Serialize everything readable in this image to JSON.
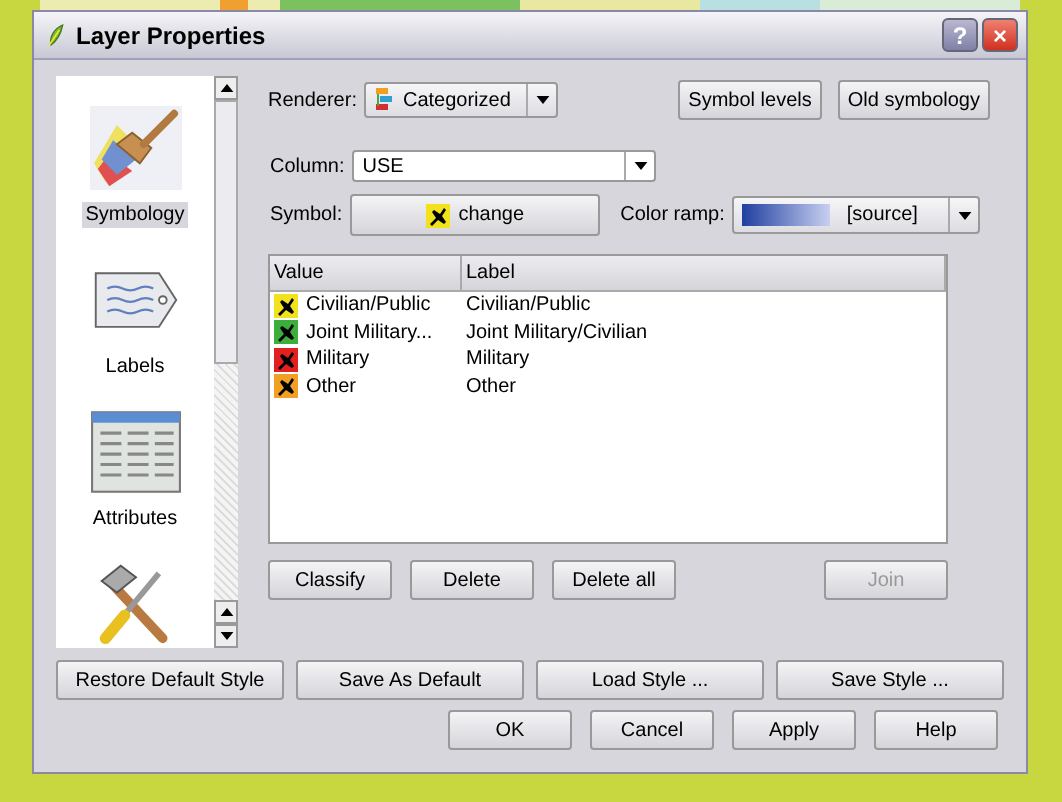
{
  "window": {
    "title": "Layer Properties",
    "buttons": [
      "?",
      "×"
    ]
  },
  "sidebar": {
    "items": [
      {
        "label": "Symbology",
        "selected": true
      },
      {
        "label": "Labels",
        "selected": false
      },
      {
        "label": "Attributes",
        "selected": false
      },
      {
        "selected": false
      }
    ]
  },
  "renderer": {
    "label": "Renderer:",
    "value": "Categorized"
  },
  "top_buttons": [
    "Symbol levels",
    "Old symbology"
  ],
  "column": {
    "label": "Column:",
    "value": "USE"
  },
  "symbol": {
    "label": "Symbol:",
    "button": "change"
  },
  "color_ramp": {
    "label": "Color ramp:",
    "value": "[source]"
  },
  "table": {
    "columns": [
      "Value",
      "Label"
    ],
    "rows": [
      {
        "value": "Civilian/Public",
        "label": "Civilian/Public",
        "color": "#f2e21c"
      },
      {
        "value": "Joint Military...",
        "label": "Joint Military/Civilian",
        "color": "#3cae3c"
      },
      {
        "value": "Military",
        "label": "Military",
        "color": "#e22020"
      },
      {
        "value": "Other",
        "label": "Other",
        "color": "#f2a024"
      }
    ]
  },
  "table_buttons": [
    {
      "label": "Classify",
      "disabled": false
    },
    {
      "label": "Delete",
      "disabled": false
    },
    {
      "label": "Delete all",
      "disabled": false
    },
    {
      "label": "Join",
      "disabled": true
    }
  ],
  "style_buttons": [
    "Restore Default Style",
    "Save As Default",
    "Load Style ...",
    "Save Style ..."
  ],
  "dialog_buttons": [
    "OK",
    "Cancel",
    "Apply",
    "Help"
  ]
}
